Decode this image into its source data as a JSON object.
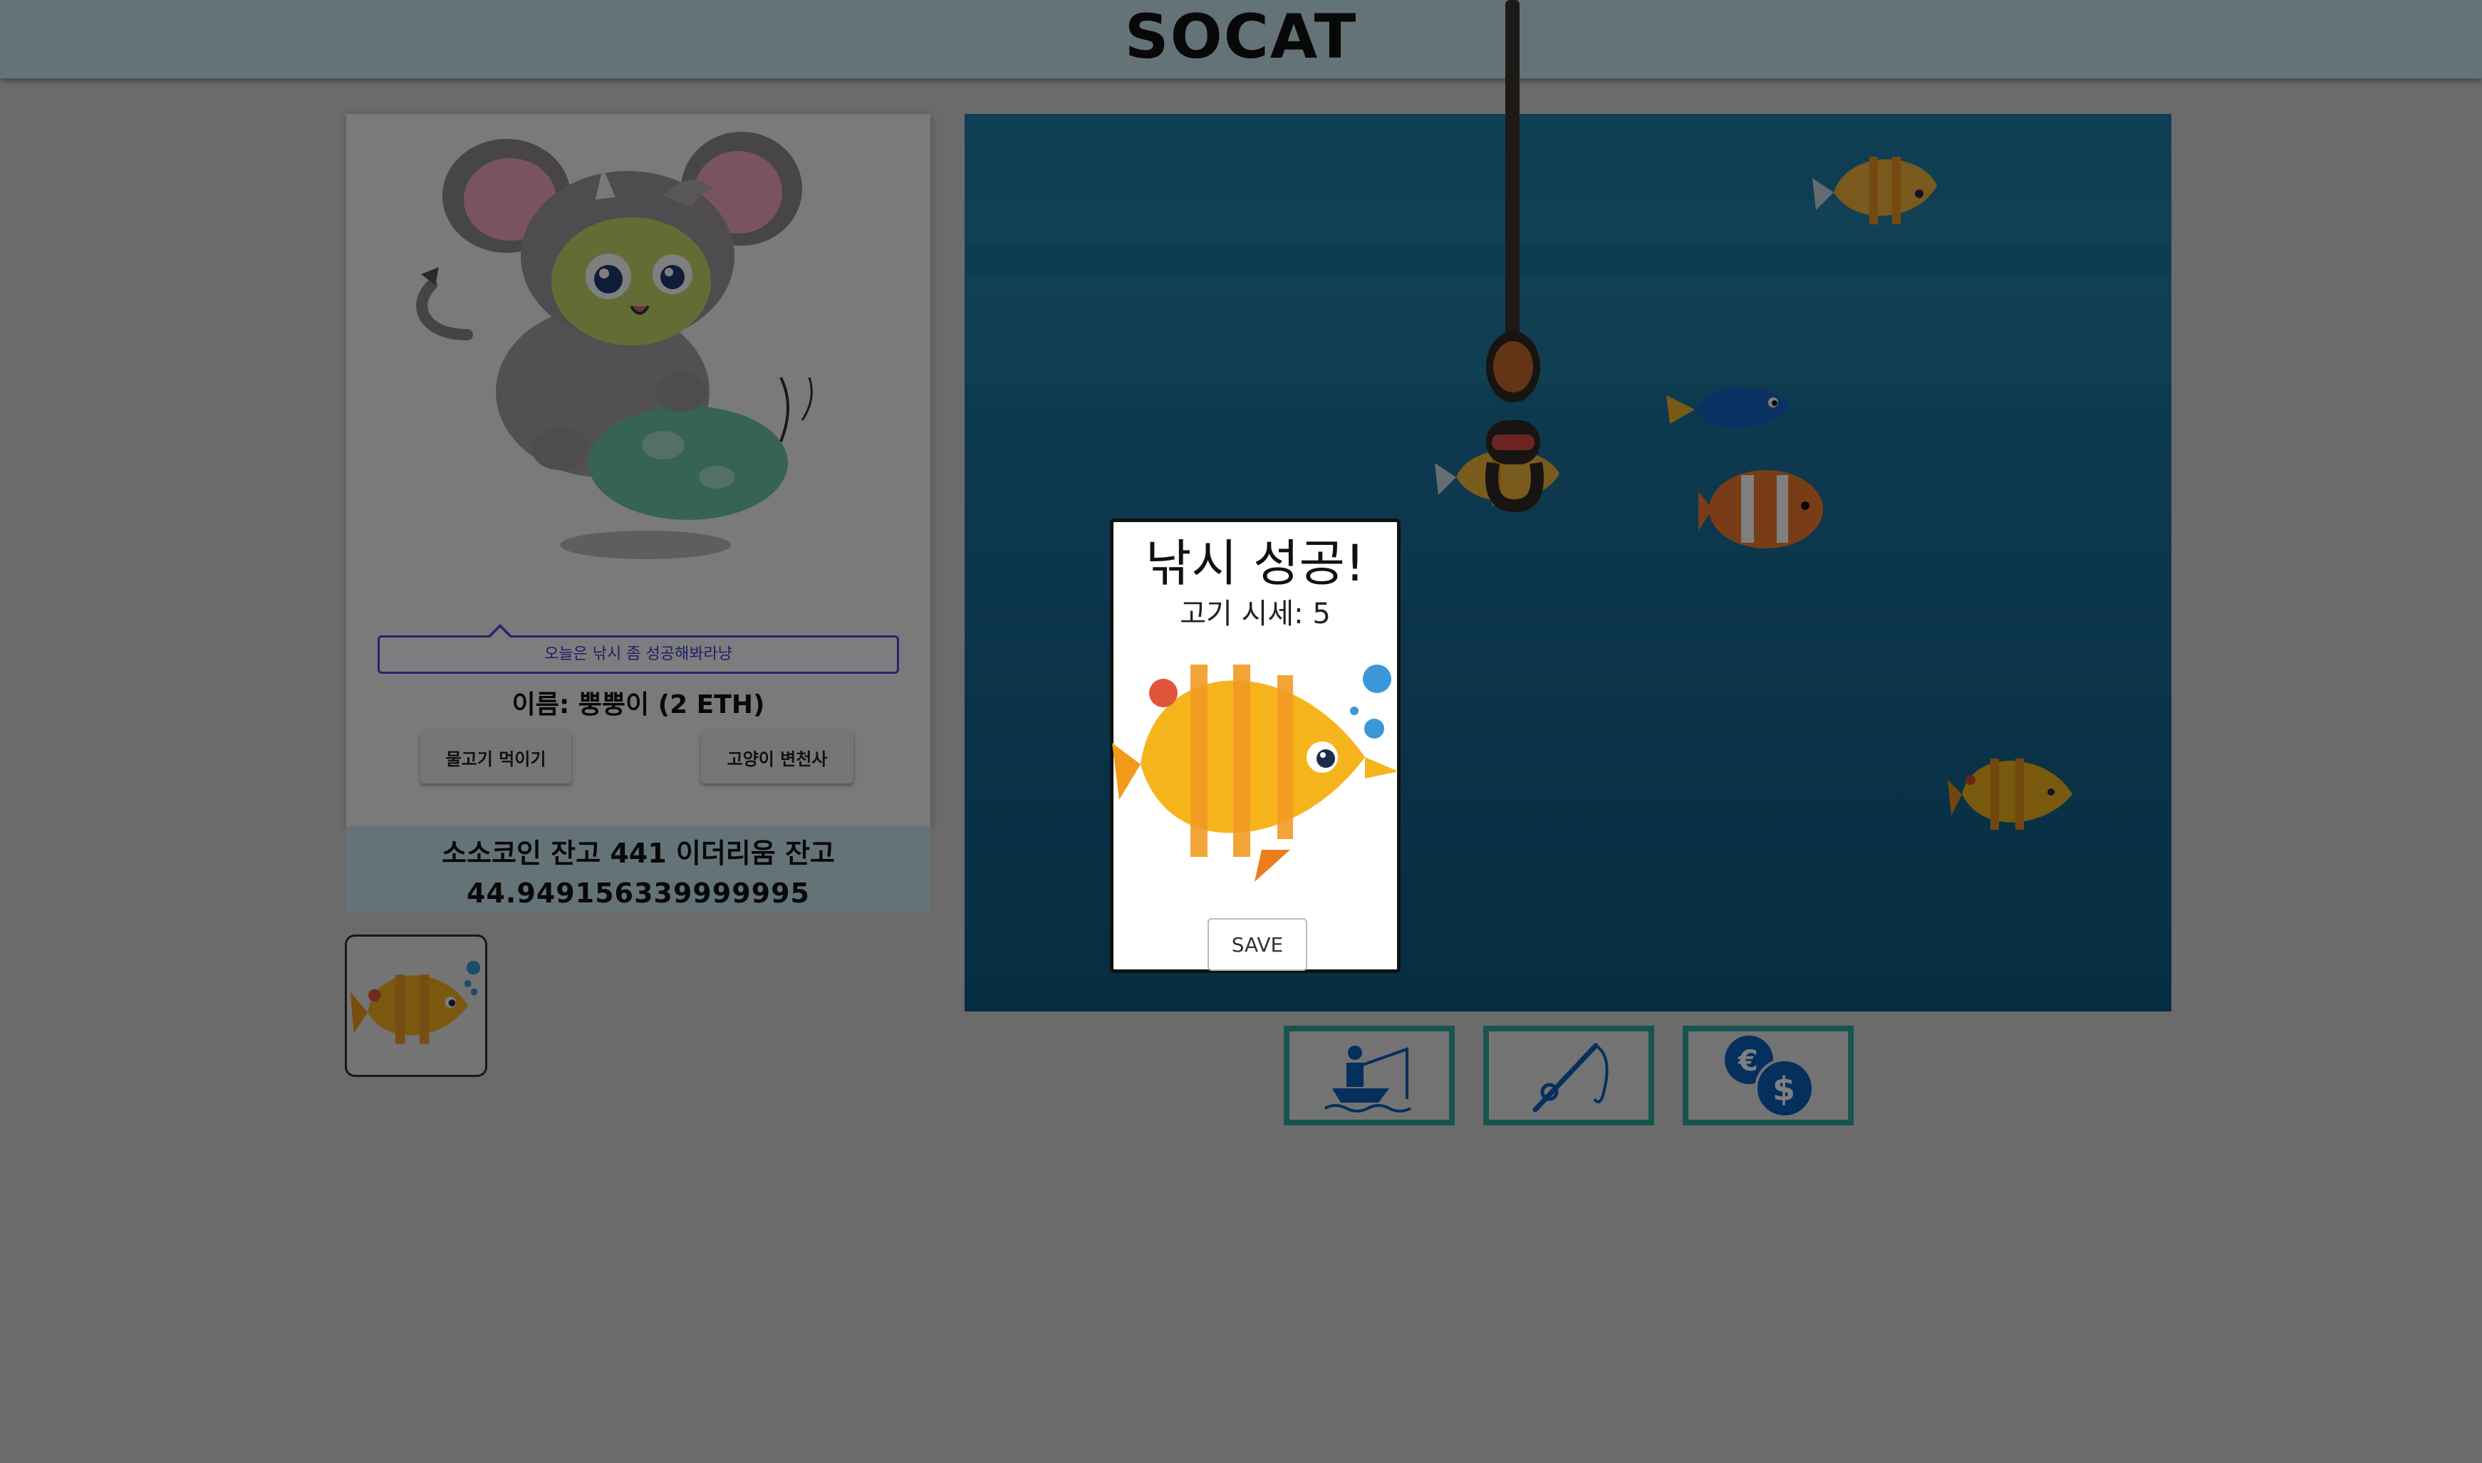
{
  "app": {
    "title": "SOCAT"
  },
  "cat_card": {
    "speech": "오늘은 낚시 좀 성공해봐라냥",
    "name": "이름: 뿡뿡이 (2 ETH)",
    "feed_label": "물고기 먹이기",
    "transform_label": "고양이 변천사"
  },
  "balance": {
    "line1": "소소코인 잔고 441 이더리움 잔고",
    "line2": "44.949156339999995"
  },
  "inventory": {
    "items": [
      "yellow-striped-fish"
    ]
  },
  "modal": {
    "title": "낚시 성공!",
    "price": "고기 시세: 5",
    "save_label": "SAVE"
  },
  "action_buttons": [
    {
      "icon": "fishing-boat-icon"
    },
    {
      "icon": "fishing-rod-icon"
    },
    {
      "icon": "currency-exchange-icon"
    }
  ],
  "colors": {
    "header_bg": "#c9e6ee",
    "accent_border": "#2ea8a0",
    "sea_top": "#1e7fa8",
    "sea_bottom": "#0e5a84",
    "bubble_border": "#4b4bd8",
    "icon_blue": "#0a5fb8"
  }
}
